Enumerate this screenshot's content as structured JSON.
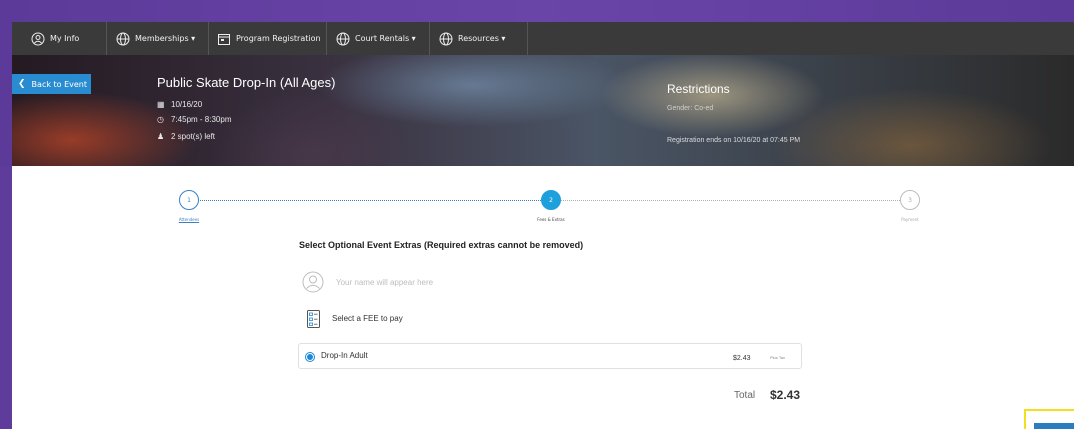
{
  "colors": {
    "accent": "#1ea0dc",
    "back_button": "#2a8cd0",
    "nav_bg": "#3a3a3a",
    "frame": "#6a45a8"
  },
  "nav": {
    "items": [
      {
        "label": "My Info",
        "icon": "user-circle-icon"
      },
      {
        "label": "Memberships ▾",
        "icon": "globe-icon"
      },
      {
        "label": "Program Registration",
        "icon": "calendar-icon"
      },
      {
        "label": "Court Rentals ▾",
        "icon": "globe-icon"
      },
      {
        "label": "Resources ▾",
        "icon": "globe-icon"
      }
    ]
  },
  "event": {
    "back_label": "Back to Event",
    "title": "Public Skate Drop-In (All Ages)",
    "date": "10/16/20",
    "time": "7:45pm - 8:30pm",
    "spots": "2 spot(s) left"
  },
  "restrictions": {
    "title": "Restrictions",
    "gender": "Gender: Co-ed",
    "ends": "Registration ends on 10/16/20 at 07:45 PM"
  },
  "stepper": {
    "steps": [
      {
        "number": "1",
        "label": "Attendees",
        "state": "done"
      },
      {
        "number": "2",
        "label": "Fees & Extras",
        "state": "active"
      },
      {
        "number": "3",
        "label": "Payment",
        "state": "todo"
      }
    ]
  },
  "extras": {
    "title": "Select Optional Event Extras (Required extras cannot be removed)",
    "name_placeholder": "Your name will appear here",
    "fee_prompt": "Select a FEE to pay",
    "fees": [
      {
        "name": "Drop-In Adult",
        "price": "$2.43",
        "tax_note": "Plus Tax",
        "selected": true
      }
    ],
    "total_label": "Total",
    "total_value": "$2.43"
  }
}
